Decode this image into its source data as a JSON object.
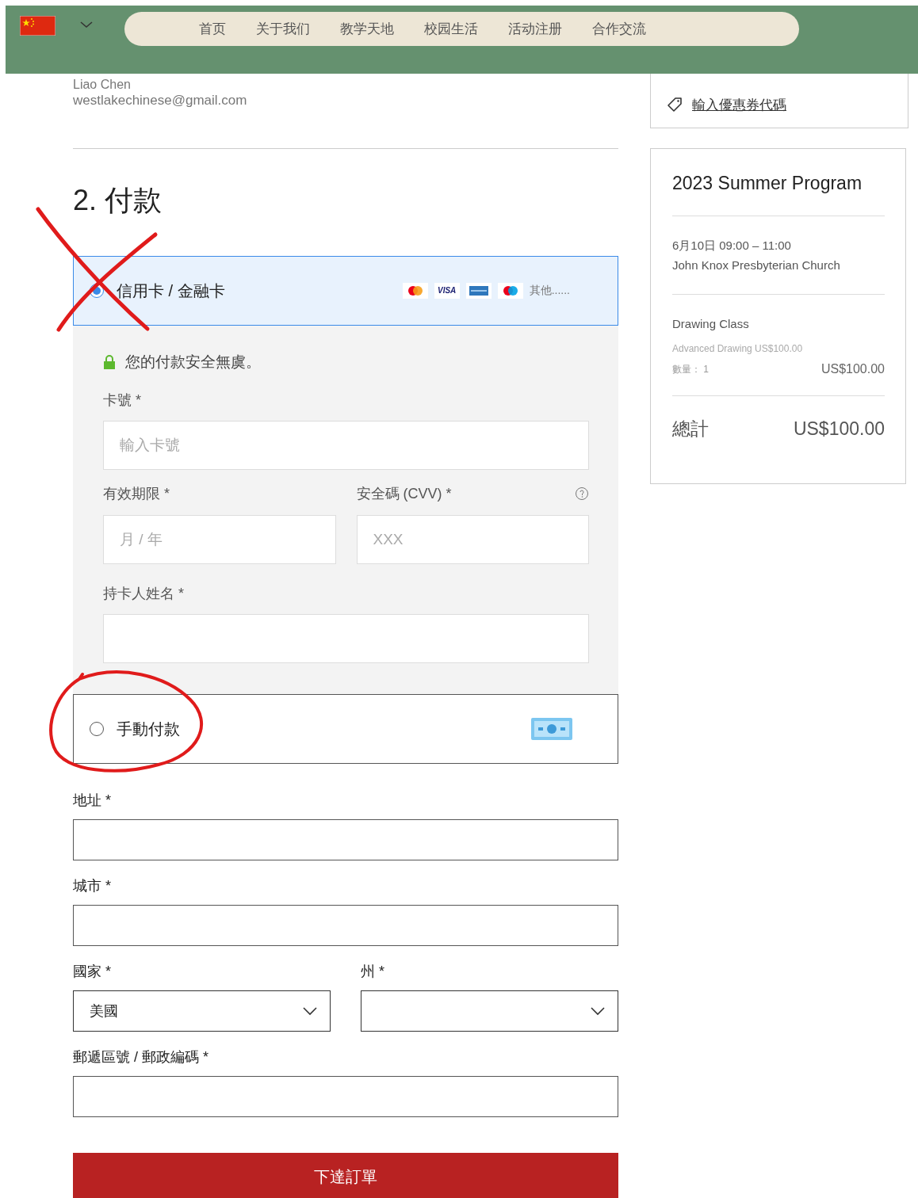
{
  "header": {
    "nav": [
      {
        "label": "首页"
      },
      {
        "label": "关于我们"
      },
      {
        "label": "教学天地"
      },
      {
        "label": "校园生活"
      },
      {
        "label": "活动注册"
      },
      {
        "label": "合作交流"
      }
    ]
  },
  "contact": {
    "name": "Liao Chen",
    "email": "westlakechinese@gmail.com"
  },
  "payment": {
    "heading": "2.  付款",
    "methods": [
      {
        "kind": "card",
        "label": "信用卡 / 金融卡",
        "selected": true,
        "brands": [
          {
            "kind": "mastercard"
          },
          {
            "kind": "visa",
            "label": "VISA"
          },
          {
            "kind": "amex"
          },
          {
            "kind": "maestro"
          }
        ],
        "more": "其他......"
      },
      {
        "kind": "manual",
        "label": "手動付款",
        "selected": false
      }
    ],
    "secure_note": "您的付款安全無虞。",
    "card_fields": [
      {
        "label": "卡號 *",
        "placeholder": "輸入卡號"
      },
      {
        "label": "有效期限 *",
        "placeholder": "月 / 年"
      },
      {
        "label": "安全碼 (CVV) *",
        "placeholder": "XXX",
        "help": true
      },
      {
        "label": "持卡人姓名 *"
      }
    ]
  },
  "address_fields": [
    {
      "kind": "text",
      "label": "地址 *"
    },
    {
      "kind": "text",
      "label": "城市 *"
    },
    {
      "kind": "select",
      "label": "國家 *",
      "value": "美國"
    },
    {
      "kind": "select",
      "label": "州 *"
    },
    {
      "kind": "text",
      "label": "郵遞區號 / 郵政編碼 *"
    }
  ],
  "submit": {
    "label": "下達訂單"
  },
  "summary": {
    "coupon_link": "輸入優惠券代碼",
    "title": "2023 Summer Program",
    "date": "6月10日 09:00 – 11:00",
    "location": "John Knox Presbyterian Church",
    "item_name": "Drawing Class",
    "item_option": "Advanced Drawing US$100.00",
    "quantity": "數量：  1",
    "item_price": "US$100.00",
    "total_label": "總計",
    "total": "US$100.00"
  }
}
